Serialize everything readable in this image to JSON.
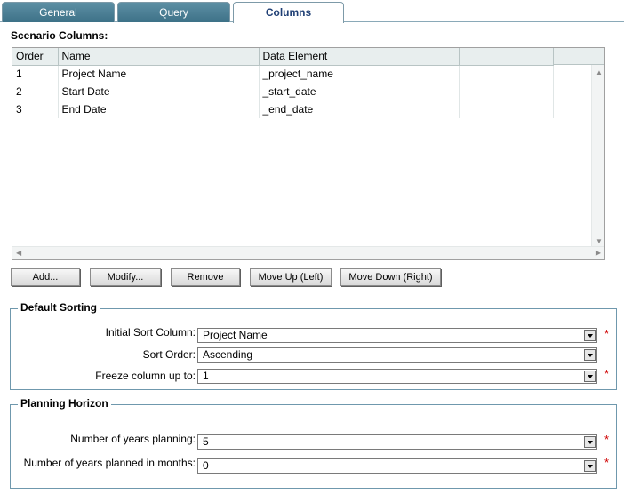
{
  "tabs": [
    {
      "label": "General"
    },
    {
      "label": "Query"
    },
    {
      "label": "Columns"
    }
  ],
  "scenario_columns": {
    "title": "Scenario Columns:",
    "headers": {
      "order": "Order",
      "name": "Name",
      "data_element": "Data Element",
      "extra": ""
    },
    "rows": [
      {
        "order": "1",
        "name": "Project Name",
        "data_element": "_project_name"
      },
      {
        "order": "2",
        "name": "Start Date",
        "data_element": "_start_date"
      },
      {
        "order": "3",
        "name": "End Date",
        "data_element": "_end_date"
      }
    ]
  },
  "buttons": {
    "add": "Add...",
    "modify": "Modify...",
    "remove": "Remove",
    "move_up": "Move Up (Left)",
    "move_down": "Move Down (Right)"
  },
  "default_sorting": {
    "title": "Default Sorting",
    "initial_sort_label": "Initial Sort Column:",
    "initial_sort_value": "Project Name",
    "sort_order_label": "Sort Order:",
    "sort_order_value": "Ascending",
    "freeze_label": "Freeze column up to:",
    "freeze_value": "1"
  },
  "planning_horizon": {
    "title": "Planning Horizon",
    "years_label": "Number of years planning:",
    "years_value": "5",
    "months_label": "Number of years planned in months:",
    "months_value": "0"
  },
  "required_marker": "*",
  "colors": {
    "tab_inactive": "#4a7d92",
    "tab_active_text": "#1f3f75",
    "group_border": "#6f98ad",
    "required": "#d00000"
  }
}
